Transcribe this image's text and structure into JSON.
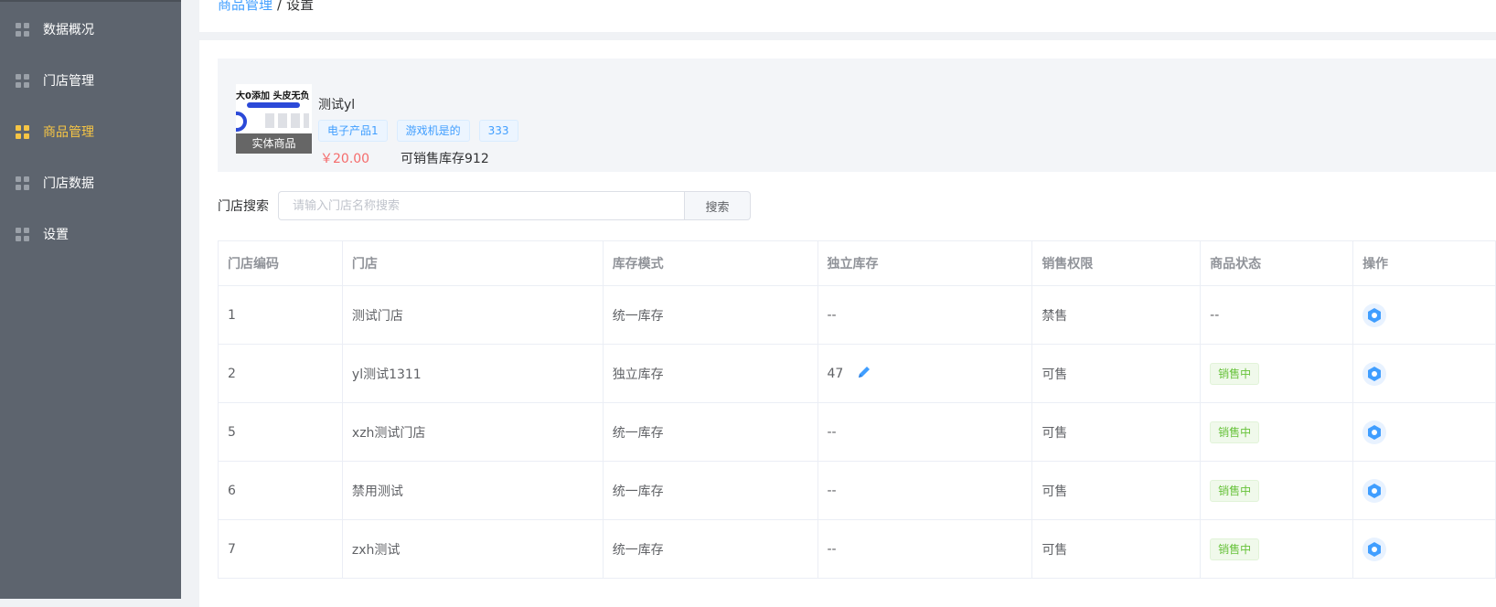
{
  "sidebar": {
    "items": [
      {
        "label": "数据概况",
        "icon": "grid-icon",
        "active": false
      },
      {
        "label": "门店管理",
        "icon": "grid-icon",
        "active": false
      },
      {
        "label": "商品管理",
        "icon": "grid-icon",
        "active": true
      },
      {
        "label": "门店数据",
        "icon": "grid-icon",
        "active": false
      },
      {
        "label": "设置",
        "icon": "grid-icon",
        "active": false
      }
    ]
  },
  "breadcrumb": {
    "parent": "商品管理",
    "separator": "/",
    "current": "设置"
  },
  "product": {
    "thumb_text": "大0添加 头皮无负",
    "type_label": "实体商品",
    "name": "测试yl",
    "tags": [
      "电子产品1",
      "游戏机是的",
      "333"
    ],
    "price": "￥20.00",
    "stock": "可销售库存912"
  },
  "search": {
    "label": "门店搜索",
    "placeholder": "请输入门店名称搜索",
    "button": "搜索"
  },
  "table": {
    "headers": [
      "门店编码",
      "门店",
      "库存模式",
      "独立库存",
      "销售权限",
      "商品状态",
      "操作"
    ],
    "rows": [
      {
        "code": "1",
        "store": "测试门店",
        "mode": "统一库存",
        "stock": "--",
        "permission": "禁售",
        "status": "--"
      },
      {
        "code": "2",
        "store": "yl测试1311",
        "mode": "独立库存",
        "stock": "47",
        "permission": "可售",
        "status": "销售中"
      },
      {
        "code": "5",
        "store": "xzh测试门店",
        "mode": "统一库存",
        "stock": "--",
        "permission": "可售",
        "status": "销售中"
      },
      {
        "code": "6",
        "store": "禁用测试",
        "mode": "统一库存",
        "stock": "--",
        "permission": "可售",
        "status": "销售中"
      },
      {
        "code": "7",
        "store": "zxh测试",
        "mode": "统一库存",
        "stock": "--",
        "permission": "可售",
        "status": "销售中"
      }
    ]
  },
  "colors": {
    "sidebar_bg": "#5d646e",
    "active": "#f6c544",
    "link": "#409eff",
    "price": "#f56c6c",
    "status_green": "#67c23a"
  }
}
